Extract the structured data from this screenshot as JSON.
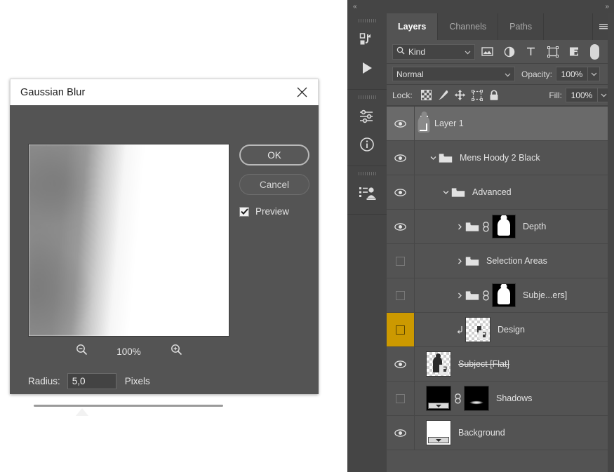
{
  "dialog": {
    "title": "Gaussian Blur",
    "close_icon": "close-icon",
    "ok_label": "OK",
    "cancel_label": "Cancel",
    "preview_label": "Preview",
    "preview_checked": true,
    "zoom_out_icon": "zoom-out-icon",
    "zoom_in_icon": "zoom-in-icon",
    "zoom_level": "100%",
    "radius_label": "Radius:",
    "radius_value": "5,0",
    "radius_units": "Pixels"
  },
  "dock": {
    "collapse_icon": "double-chevron-left-icon",
    "expand_icon": "double-chevron-right-icon",
    "rail": [
      {
        "name": "history-icon"
      },
      {
        "name": "play-icon"
      },
      {
        "name": "adjustments-icon"
      },
      {
        "name": "info-icon"
      },
      {
        "name": "libraries-icon"
      }
    ],
    "tabs": [
      {
        "label": "Layers",
        "active": true
      },
      {
        "label": "Channels",
        "active": false
      },
      {
        "label": "Paths",
        "active": false
      }
    ],
    "menu_icon": "panel-menu-icon"
  },
  "filter": {
    "search_icon": "search-icon",
    "kind_label": "Kind",
    "chevron_icon": "chevron-down-icon",
    "icons": [
      {
        "name": "pixel-layer-filter-icon"
      },
      {
        "name": "adjustment-layer-filter-icon"
      },
      {
        "name": "type-layer-filter-icon"
      },
      {
        "name": "shape-layer-filter-icon"
      },
      {
        "name": "smart-object-filter-icon"
      }
    ],
    "toggle_name": "filter-enable-toggle"
  },
  "blend": {
    "mode": "Normal",
    "opacity_label": "Opacity:",
    "opacity_value": "100%"
  },
  "lock": {
    "label": "Lock:",
    "icons": [
      {
        "name": "lock-transparent-pixels-icon"
      },
      {
        "name": "lock-image-pixels-icon"
      },
      {
        "name": "lock-position-icon"
      },
      {
        "name": "lock-artboard-nesting-icon"
      },
      {
        "name": "lock-all-icon"
      }
    ],
    "fill_label": "Fill:",
    "fill_value": "100%"
  },
  "layers": [
    {
      "name": "Layer 1",
      "visible": true,
      "selected": true,
      "indent": 0,
      "type": "pixel",
      "thumb": "torso",
      "disclosure": "",
      "linked": false,
      "clipped": false,
      "strike": false,
      "marked": false
    },
    {
      "name": "Mens Hoody 2 Black",
      "visible": true,
      "selected": false,
      "indent": 0,
      "type": "group",
      "thumb": "folder",
      "disclosure": "open",
      "linked": false,
      "clipped": false,
      "strike": false,
      "marked": false
    },
    {
      "name": "Advanced",
      "visible": true,
      "selected": false,
      "indent": 1,
      "type": "group",
      "thumb": "folder",
      "disclosure": "open",
      "linked": false,
      "clipped": false,
      "strike": false,
      "marked": false
    },
    {
      "name": "Depth",
      "visible": true,
      "selected": false,
      "indent": 2,
      "type": "group",
      "thumb": "hoodie-mask",
      "disclosure": "closed",
      "linked": true,
      "clipped": false,
      "strike": false,
      "marked": false
    },
    {
      "name": "Selection Areas",
      "visible": false,
      "selected": false,
      "indent": 2,
      "type": "group",
      "thumb": "none",
      "disclosure": "closed",
      "linked": false,
      "clipped": false,
      "strike": false,
      "marked": false
    },
    {
      "name": "Subje...ers]",
      "visible": false,
      "selected": false,
      "indent": 2,
      "type": "group",
      "thumb": "hoodie-mask",
      "disclosure": "closed",
      "linked": true,
      "clipped": false,
      "strike": false,
      "marked": false
    },
    {
      "name": "Design",
      "visible": false,
      "selected": false,
      "indent": 1,
      "type": "smart",
      "thumb": "design",
      "disclosure": "",
      "linked": false,
      "clipped": true,
      "strike": false,
      "marked": true
    },
    {
      "name": "Subject [Flat]",
      "visible": true,
      "selected": false,
      "indent": 0,
      "type": "smart",
      "thumb": "subject",
      "disclosure": "",
      "linked": false,
      "clipped": false,
      "strike": true,
      "marked": false
    },
    {
      "name": "Shadows",
      "visible": false,
      "selected": false,
      "indent": 0,
      "type": "smart",
      "thumb": "shadow",
      "disclosure": "",
      "linked": true,
      "clipped": false,
      "strike": false,
      "marked": false
    },
    {
      "name": "Background",
      "visible": true,
      "selected": false,
      "indent": 0,
      "type": "smart",
      "thumb": "white",
      "disclosure": "",
      "linked": false,
      "clipped": false,
      "strike": false,
      "marked": false
    }
  ],
  "colors": {
    "panel_bg": "#535353",
    "panel_dark": "#454545",
    "dialog_bg": "#545454",
    "selected_row": "#6a6a6a",
    "marker_yellow": "#cc9900",
    "text": "#e2e2e2"
  }
}
